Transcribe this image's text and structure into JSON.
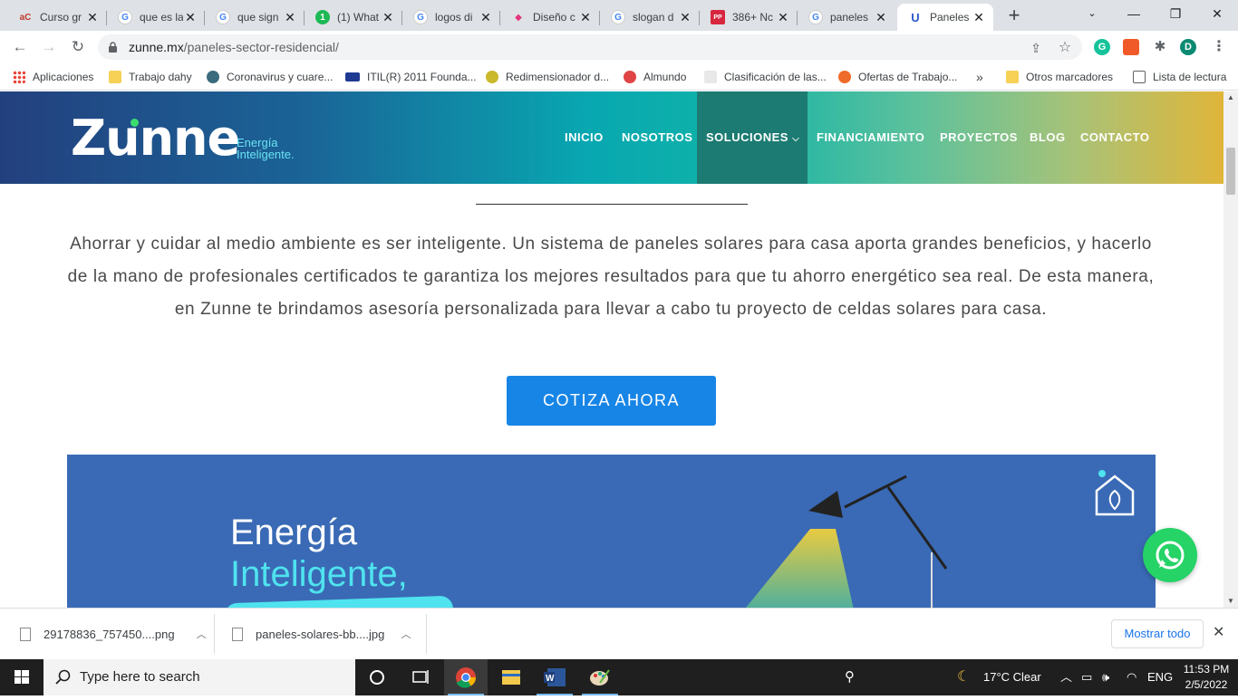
{
  "browser": {
    "tabs": [
      {
        "title": "Curso gr",
        "favicon": "aC"
      },
      {
        "title": "que es la",
        "favicon": "G"
      },
      {
        "title": "que sign",
        "favicon": "G"
      },
      {
        "title": "(1) What",
        "favicon": "1"
      },
      {
        "title": "logos di",
        "favicon": "G"
      },
      {
        "title": "Diseño c",
        "favicon": "◆"
      },
      {
        "title": "slogan d",
        "favicon": "G"
      },
      {
        "title": "386+ Nc",
        "favicon": "PP"
      },
      {
        "title": "paneles",
        "favicon": "G"
      },
      {
        "title": "Paneles",
        "favicon": "U"
      }
    ],
    "active_tab": 9,
    "url_host": "zunne.mx",
    "url_path": "/paneles-sector-residencial/",
    "profile_initial": "D",
    "bookmarks": [
      "Aplicaciones",
      "Trabajo dahy",
      "Coronavirus y cuare...",
      "ITIL(R) 2011 Founda...",
      "Redimensionador d...",
      "Almundo",
      "Clasificación de las...",
      "Ofertas de Trabajo..."
    ],
    "bookmarks_more": "»",
    "other_bookmarks": "Otros marcadores",
    "reading_list": "Lista de lectura"
  },
  "site": {
    "logo_word": "Zunne",
    "logo_tag_line1": "Energía",
    "logo_tag_line2": "Inteligente.",
    "nav": [
      "INICIO",
      "NOSOTROS",
      "SOLUCIONES",
      "FINANCIAMIENTO",
      "PROYECTOS",
      "BLOG",
      "CONTACTO"
    ],
    "nav_current": "SOLUCIONES",
    "intro": "Ahorrar y cuidar al medio ambiente es ser inteligente. Un sistema de paneles solares para casa aporta grandes beneficios, y hacerlo de la mano de profesionales certificados te garantiza los mejores resultados para que tu ahorro energético sea real.  De esta manera, en Zunne te brindamos asesoría personalizada para llevar a cabo tu proyecto de celdas solares para casa.",
    "cta": "COTIZA AHORA",
    "banner_line1": "Energía",
    "banner_line2": "Inteligente,"
  },
  "downloads": {
    "items": [
      "29178836_757450....png",
      "paneles-solares-bb....jpg"
    ],
    "show_all": "Mostrar todo"
  },
  "taskbar": {
    "search_placeholder": "Type here to search",
    "weather": "17°C  Clear",
    "lang": "ENG",
    "time": "11:53 PM",
    "date": "2/5/2022"
  },
  "colors": {
    "cta_blue": "#1785e6",
    "nav_current_bg": "#1c7b72",
    "banner_blue": "#3a6ab5",
    "whatsapp_green": "#25d366"
  }
}
